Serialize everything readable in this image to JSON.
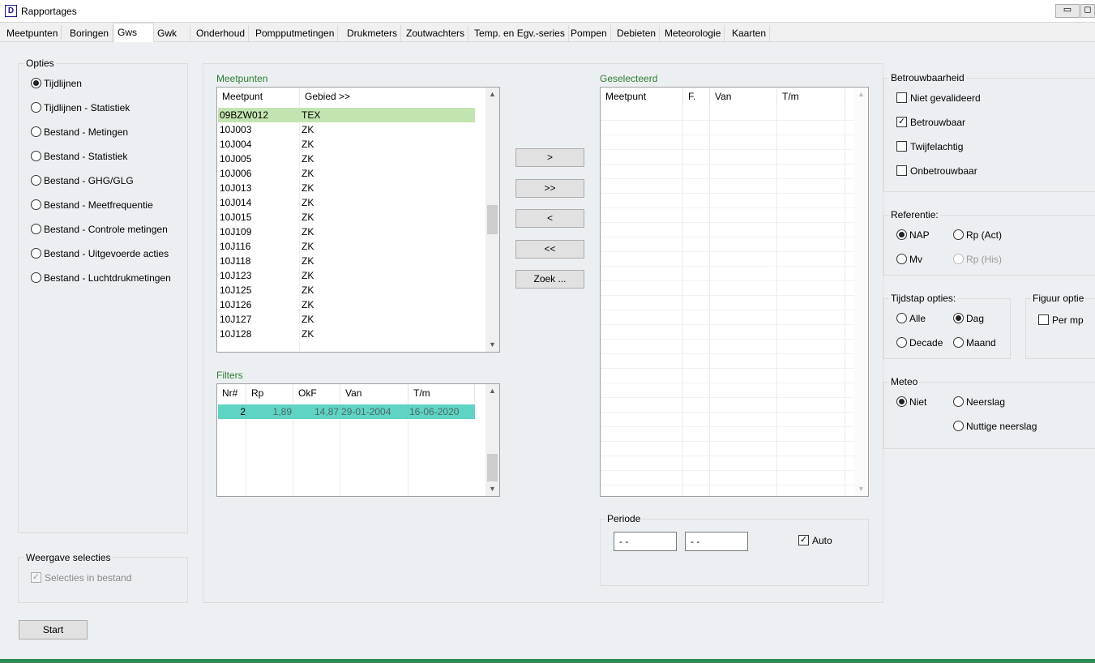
{
  "window": {
    "title": "Rapportages",
    "icon": "D",
    "minimize": "▭",
    "restore": "◻"
  },
  "tabs": [
    "Meetpunten",
    "Boringen",
    "Gws",
    "Gwk",
    "Onderhoud",
    "Pompputmetingen",
    "Drukmeters",
    "Zoutwachters",
    "Temp. en Egv.-series",
    "Pompen",
    "Debieten",
    "Meteorologie",
    "Kaarten"
  ],
  "opties": {
    "title": "Opties",
    "items": [
      "Tijdlijnen",
      "Tijdlijnen - Statistiek",
      "Bestand - Metingen",
      "Bestand - Statistiek",
      "Bestand - GHG/GLG",
      "Bestand - Meetfrequentie",
      "Bestand - Controle metingen",
      "Bestand - Uitgevoerde acties",
      "Bestand - Luchtdrukmetingen"
    ]
  },
  "weergave": {
    "title": "Weergave selecties",
    "checkbox": "Selecties in bestand"
  },
  "start_button": "Start",
  "meetpunten": {
    "title": "Meetpunten",
    "columns": [
      "Meetpunt",
      "Gebied >>"
    ],
    "rows": [
      [
        "09BZW012",
        "TEX"
      ],
      [
        "10J003",
        "ZK"
      ],
      [
        "10J004",
        "ZK"
      ],
      [
        "10J005",
        "ZK"
      ],
      [
        "10J006",
        "ZK"
      ],
      [
        "10J013",
        "ZK"
      ],
      [
        "10J014",
        "ZK"
      ],
      [
        "10J015",
        "ZK"
      ],
      [
        "10J109",
        "ZK"
      ],
      [
        "10J116",
        "ZK"
      ],
      [
        "10J118",
        "ZK"
      ],
      [
        "10J123",
        "ZK"
      ],
      [
        "10J125",
        "ZK"
      ],
      [
        "10J126",
        "ZK"
      ],
      [
        "10J127",
        "ZK"
      ],
      [
        "10J128",
        "ZK"
      ]
    ]
  },
  "filters": {
    "title": "Filters",
    "columns": [
      "Nr#",
      "Rp",
      "OkF",
      "Van",
      "T/m"
    ],
    "rows": [
      [
        "2",
        "1,89",
        "14,87",
        "29-01-2004",
        "16-06-2020"
      ]
    ]
  },
  "transfer_buttons": [
    ">",
    ">>",
    "<",
    "<<",
    "Zoek ..."
  ],
  "geselecteerd": {
    "title": "Geselecteerd",
    "columns": [
      "Meetpunt",
      "F.",
      "Van",
      "T/m"
    ]
  },
  "periode": {
    "title": "Periode",
    "from": "- -",
    "to": "- -",
    "auto": "Auto"
  },
  "betrouwbaarheid": {
    "title": "Betrouwbaarheid",
    "items": [
      "Niet gevalideerd",
      "Betrouwbaar",
      "Twijfelachtig",
      "Onbetrouwbaar"
    ]
  },
  "referentie": {
    "title": "Referentie:",
    "nap": "NAP",
    "rp_act": "Rp (Act)",
    "mv": "Mv",
    "rp_his": "Rp (His)"
  },
  "tijdstap": {
    "title": "Tijdstap opties:",
    "alle": "Alle",
    "dag": "Dag",
    "decade": "Decade",
    "maand": "Maand"
  },
  "figuur": {
    "title": "Figuur optie",
    "per_mp": "Per mp"
  },
  "meteo": {
    "title": "Meteo",
    "niet": "Niet",
    "neerslag": "Neerslag",
    "nuttige": "Nuttige neerslag"
  },
  "colors": {
    "selected_row": "#c2e4b0",
    "filter_row": "#5fd3c4",
    "group_title": "#2e7d32"
  },
  "icons": {
    "scroll_up": "▲",
    "scroll_down": "▼",
    "check": "✓"
  }
}
